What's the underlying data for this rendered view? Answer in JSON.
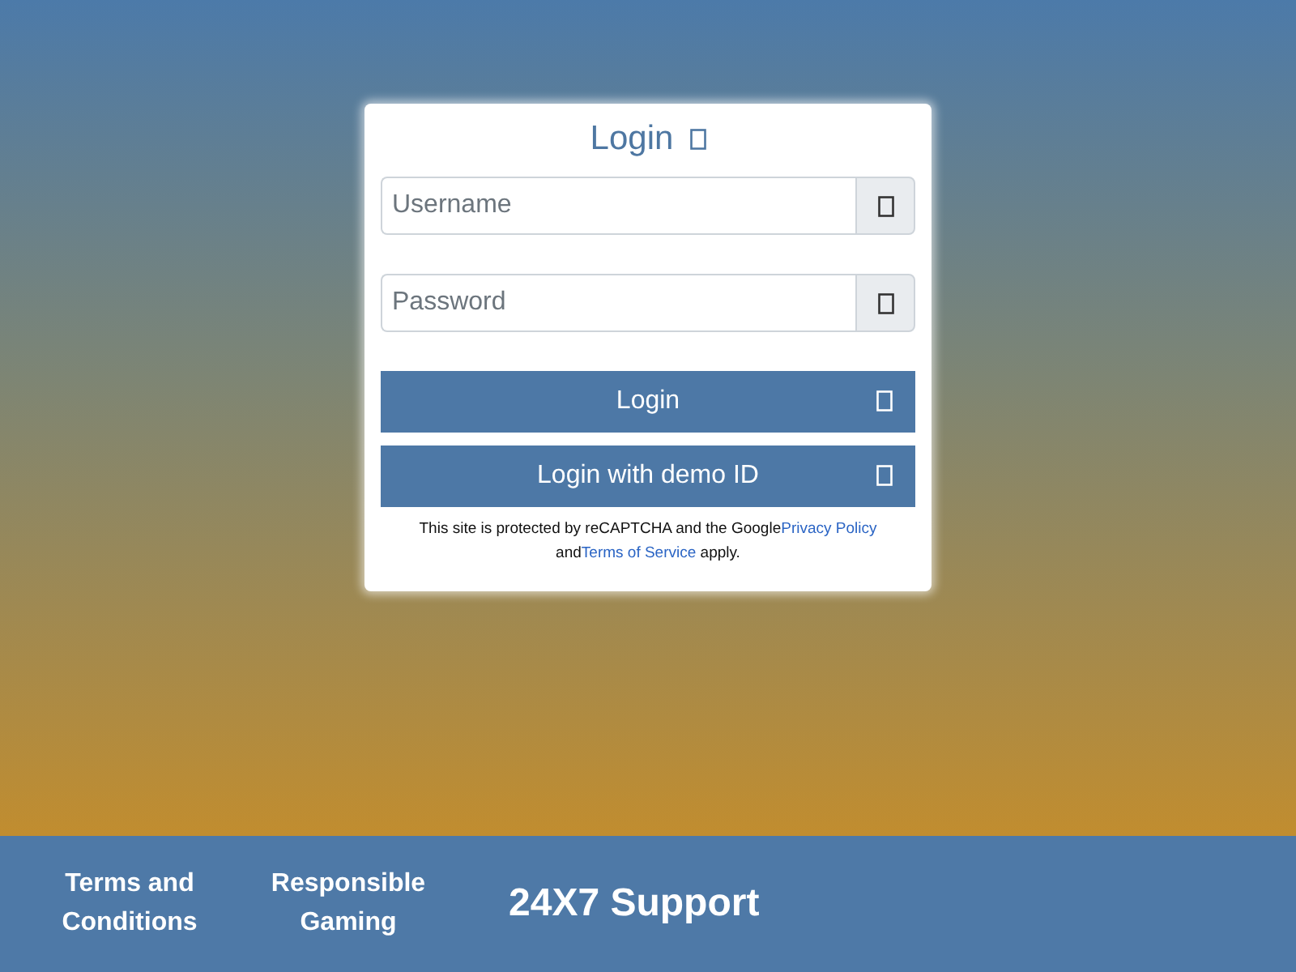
{
  "login_card": {
    "title": "Login",
    "fields": [
      {
        "placeholder": "Username"
      },
      {
        "placeholder": "Password"
      }
    ],
    "buttons": [
      "Login",
      "Login with demo ID"
    ],
    "notice": {
      "text_before": "This site is protected by reCAPTCHA and the Google",
      "privacy_link": "Privacy Policy",
      "text_middle": "and",
      "terms_link": "Terms of Service",
      "text_after": " apply."
    }
  },
  "footer": {
    "links": [
      "Terms and Conditions",
      "Responsible Gaming"
    ],
    "support": "24X7 Support"
  }
}
